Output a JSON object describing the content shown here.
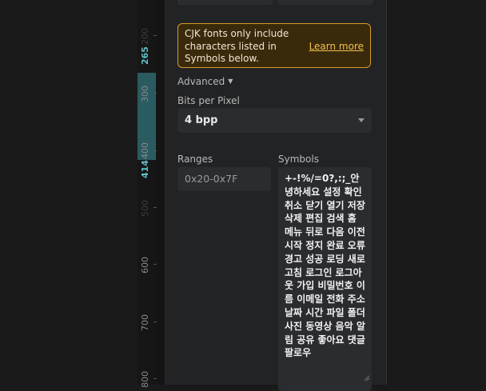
{
  "ruler": {
    "labels": [
      "200",
      "265",
      "300",
      "400",
      "414",
      "500",
      "600",
      "700",
      "800"
    ]
  },
  "notice": {
    "text": "CJK fonts only include characters listed in Symbols below.",
    "link": "Learn more"
  },
  "advanced": {
    "label": "Advanced",
    "arrow": "▼"
  },
  "bpp": {
    "label": "Bits per Pixel",
    "value": "4 bpp"
  },
  "ranges": {
    "label": "Ranges",
    "value": "0x20-0x7F"
  },
  "symbols": {
    "label": "Symbols",
    "value": "+-!%/=0?,:;_안녕하세요 설정 확인 취소 닫기 열기 저장 삭제 편집 검색 홈 메뉴 뒤로 다음 이전 시작 정지 완료 오류 경고 성공 로딩 새로고침 로그인 로그아웃 가입 비밀번호 이름 이메일 전화 주소 날짜 시간 파일 폴더 사진 동영상 음악 알림 공유 좋아요 댓글 팔로우"
  },
  "colors": {
    "accent": "#5fc0c9",
    "ruler_selection": "#2a5b60",
    "notice_border": "#d99a2b",
    "notice_bg": "#3a2a0c",
    "link": "#f3c04d"
  }
}
